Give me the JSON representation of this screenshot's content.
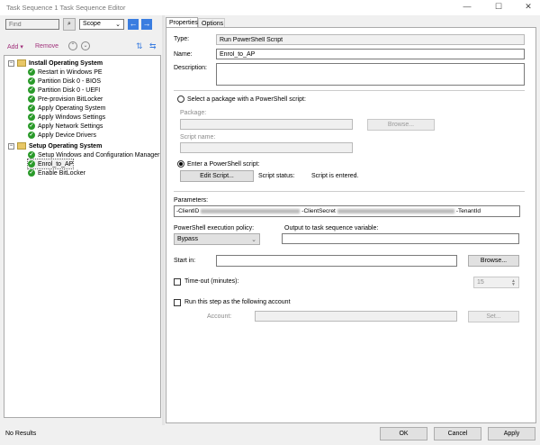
{
  "window": {
    "title": "Task Sequence 1 Task Sequence Editor"
  },
  "toolbar": {
    "find_placeholder": "Find",
    "scope": "Scope",
    "add": "Add",
    "remove": "Remove"
  },
  "tree": [
    {
      "label": "Install Operating System",
      "group": true
    },
    {
      "label": "Restart in Windows PE"
    },
    {
      "label": "Partition Disk 0 - BIOS"
    },
    {
      "label": "Partition Disk 0 - UEFI"
    },
    {
      "label": "Pre-provision BitLocker"
    },
    {
      "label": "Apply Operating System"
    },
    {
      "label": "Apply Windows Settings"
    },
    {
      "label": "Apply Network Settings"
    },
    {
      "label": "Apply Device Drivers"
    },
    {
      "label": "Setup Operating System",
      "group": true
    },
    {
      "label": "Setup Windows and Configuration Manager"
    },
    {
      "label": "Enrol_to_AP",
      "selected": true
    },
    {
      "label": "Enable BitLocker"
    }
  ],
  "tabs": [
    "Properties",
    "Options"
  ],
  "props": {
    "type_label": "Type:",
    "type_value": "Run PowerShell Script",
    "name_label": "Name:",
    "name_value": "Enrol_to_AP",
    "desc_label": "Description:",
    "pkg_radio": "Select a package with a PowerShell script:",
    "pkg_label": "Package:",
    "browse": "Browse...",
    "script_name_label": "Script name:",
    "enter_radio": "Enter a PowerShell script:",
    "edit_script": "Edit Script...",
    "script_status_label": "Script status:",
    "script_status": "Script is entered.",
    "params_label": "Parameters:",
    "param_clientid": "-ClientID",
    "param_clientsecret": "-ClientSecret",
    "param_tenantid": "-TenantId",
    "policy_label": "PowerShell execution policy:",
    "policy_value": "Bypass",
    "output_label": "Output to task sequence variable:",
    "startin_label": "Start in:",
    "startin_browse": "Browse...",
    "timeout_label": "Time-out (minutes):",
    "timeout_value": "15",
    "runas_label": "Run this step as the following account",
    "account_label": "Account:",
    "set": "Set..."
  },
  "status": "No Results",
  "buttons": {
    "ok": "OK",
    "cancel": "Cancel",
    "apply": "Apply"
  }
}
